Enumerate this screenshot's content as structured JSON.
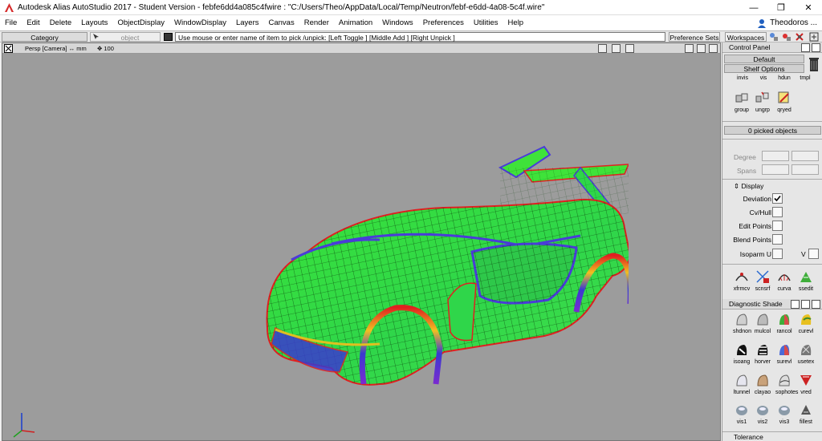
{
  "window": {
    "title": "Autodesk Alias AutoStudio 2017  - Student Version  -  febfe6dd4a085c4fwire : \"C:/Users/Theo/AppData/Local/Temp/Neutron/febf-e6dd-4a08-5c4f.wire\"",
    "minimize": "—",
    "restore": "❐",
    "close": "✕"
  },
  "menu": [
    "File",
    "Edit",
    "Delete",
    "Layouts",
    "ObjectDisplay",
    "WindowDisplay",
    "Layers",
    "Canvas",
    "Render",
    "Animation",
    "Windows",
    "Preferences",
    "Utilities",
    "Help"
  ],
  "user": {
    "name": "Theodoros ..."
  },
  "promptbar": {
    "category": "Category",
    "object": "object",
    "prompt": "Use mouse or enter name of item to pick /unpick: [Left Toggle ] [Middle Add ] [Right Unpick ]",
    "preference_sets": "Preference Sets",
    "workspaces": "Workspaces"
  },
  "viewport": {
    "label": "Persp [Camera]",
    "units": "mm",
    "zoom": "100"
  },
  "control_panel": {
    "title": "Control Panel",
    "shelf_dropdown": "Default",
    "shelf_options": "Shelf Options",
    "shelf_row1": [
      "invis",
      "vis",
      "hdun",
      "tmpl"
    ],
    "shelf_row2": [
      "group",
      "ungrp",
      "qryed"
    ],
    "picked": "0 picked objects",
    "degree_label": "Degree",
    "spans_label": "Spans",
    "display_title": "Display",
    "display_items": [
      {
        "label": "Deviation",
        "checked": true
      },
      {
        "label": "Cv/Hull",
        "checked": false
      },
      {
        "label": "Edit Points",
        "checked": false
      },
      {
        "label": "Blend Points",
        "checked": false
      },
      {
        "label": "Isoparm U",
        "checked": false
      }
    ],
    "isoparm_v": "V",
    "tools_row": [
      "xfrmcv",
      "scnsrf",
      "curva",
      "ssedit"
    ]
  },
  "diagnostic_shade": {
    "title": "Diagnostic Shade",
    "row1": [
      "shdnon",
      "mulcol",
      "rancol",
      "curevl"
    ],
    "row2": [
      "isoang",
      "horver",
      "surevl",
      "usetex"
    ],
    "row3": [
      "ltunnel",
      "clayao",
      "sophotes",
      "vred"
    ],
    "row4": [
      "vis1",
      "vis2",
      "vis3",
      "fillest"
    ],
    "tolerance": "Tolerance"
  },
  "colors": {
    "viewport_bg": "#9c9c9c",
    "deviation_green": "#3fe23a",
    "deviation_red": "#e02020",
    "deviation_blue": "#4a3cd8",
    "accent_blue": "#1f5fbf"
  }
}
